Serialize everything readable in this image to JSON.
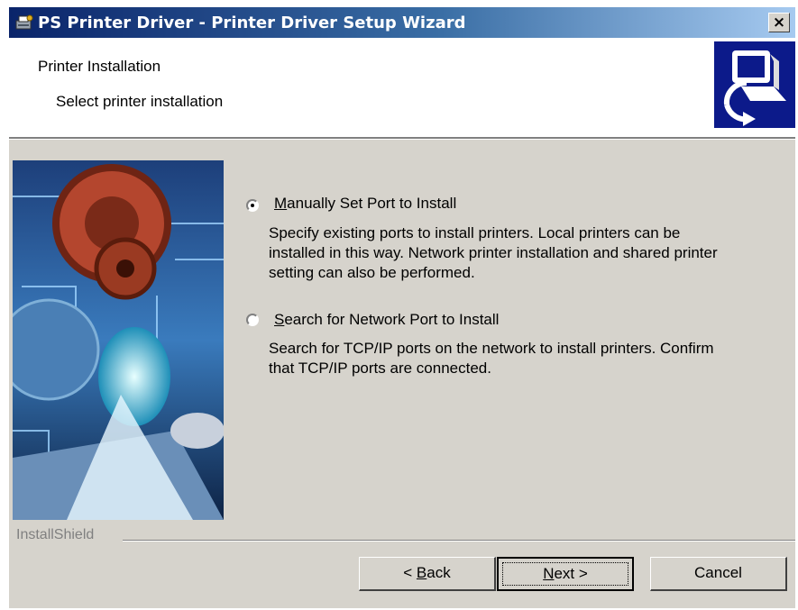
{
  "window": {
    "title": "PS Printer Driver - Printer Driver Setup Wizard",
    "close_glyph": "×",
    "icon": "printer-setup-icon"
  },
  "header": {
    "title": "Printer Installation",
    "subtitle": "Select printer installation",
    "logo_icon": "computer-install-icon"
  },
  "side_image": "gears-globe-circuit-artwork",
  "options": [
    {
      "selected": true,
      "label_mnemonic": "M",
      "label_rest": "anually Set Port to Install",
      "description_lines": [
        "Specify existing ports to install printers. Local printers can be",
        "installed in this way. Network printer installation and shared printer",
        "setting can also be performed."
      ]
    },
    {
      "selected": false,
      "label_mnemonic": "S",
      "label_rest": "earch for Network Port to Install",
      "description_lines": [
        "Search for TCP/IP ports on the network to install printers. Confirm",
        "that TCP/IP ports are connected."
      ]
    }
  ],
  "footer": {
    "brand": "InstallShield",
    "back": {
      "prefix": "< ",
      "mnemonic": "B",
      "rest": "ack"
    },
    "next": {
      "mnemonic": "N",
      "rest": "ext >"
    },
    "cancel": "Cancel"
  },
  "colors": {
    "dialog_bg": "#d6d3cc",
    "titlebar_start": "#0a246a",
    "titlebar_end": "#a6caf0",
    "logo_bg": "#0c1a8a"
  }
}
